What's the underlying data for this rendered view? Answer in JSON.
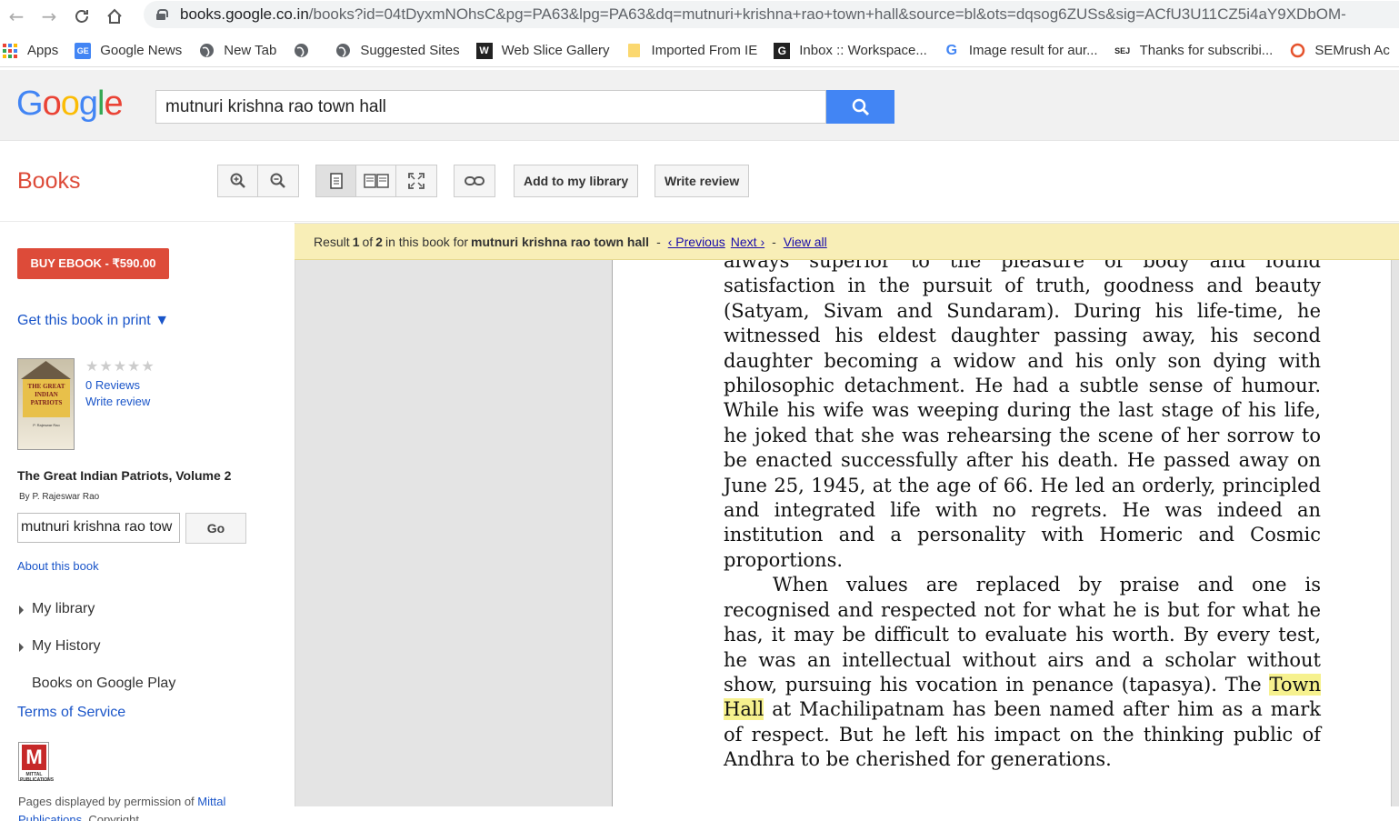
{
  "browser": {
    "url_host": "books.google.co.in",
    "url_rest": "/books?id=04tDyxmNOhsC&pg=PA63&lpg=PA63&dq=mutnuri+krishna+rao+town+hall&source=bl&ots=dqsog6ZUSs&sig=ACfU3U11CZ5i4aY9XDbOM-"
  },
  "bookmarks": [
    {
      "label": "Apps",
      "icon": "apps-grid-icon"
    },
    {
      "label": "Google News",
      "icon": "google-news-icon"
    },
    {
      "label": "New Tab",
      "icon": "globe-icon"
    },
    {
      "label": "",
      "icon": "globe-icon"
    },
    {
      "label": "Suggested Sites",
      "icon": "globe-icon"
    },
    {
      "label": "Web Slice Gallery",
      "icon": "web-slice-icon"
    },
    {
      "label": "Imported From IE",
      "icon": "folder-icon"
    },
    {
      "label": "Inbox :: Workspace...",
      "icon": "g-square-icon"
    },
    {
      "label": "Image result for aur...",
      "icon": "google-g-icon"
    },
    {
      "label": "Thanks for subscribi...",
      "icon": "sej-icon"
    },
    {
      "label": "SEMrush Ac",
      "icon": "semrush-icon"
    }
  ],
  "header": {
    "search_query": "mutnuri krishna rao town hall"
  },
  "books": {
    "title": "Books",
    "add_library_label": "Add to my library",
    "write_review_label": "Write review"
  },
  "sidebar": {
    "buy_label": "BUY EBOOK - ₹590.00",
    "get_print_label": "Get this book in print ▼",
    "reviews_label": "0 Reviews",
    "write_review_label": "Write review",
    "book_title": "The Great Indian Patriots, Volume 2",
    "author": "By P. Rajeswar Rao",
    "search_value": "mutnuri krishna rao tow",
    "go_label": "Go",
    "about_label": "About this book",
    "my_library": "My library",
    "my_history": "My History",
    "books_play": "Books on Google Play",
    "terms": "Terms of Service",
    "permission_text": "Pages displayed by permission of ",
    "publisher_link": "Mittal Publications",
    "copyright": ". Copyright.",
    "cover_title": "THE GREAT INDIAN PATRIOTS",
    "cover_author": "P. Rajeswar Rao",
    "publisher_logo_letter": "M",
    "publisher_logo_text": "MITTAL PUBLICATIONS",
    "rating": 0
  },
  "result_bar": {
    "result_label": "Result",
    "result_num": "1",
    "of_label": "of",
    "total": "2",
    "in_book_label": "in this book for",
    "query": "mutnuri krishna rao town hall",
    "sep1": "-",
    "previous": "‹ Previous",
    "next": "Next ›",
    "sep2": "-",
    "view_all": "View all"
  },
  "page_text": {
    "line0": "always superior to the pleasure of body and found",
    "para1": "satisfaction in the pursuit of truth, goodness and beauty (Satyam, Sivam and Sundaram). During his life-time, he witnessed his eldest daughter passing away, his second daughter becoming a widow and his only son dying with philosophic detachment. He had a subtle sense of humour. While his wife was weeping during the last stage of his life, he joked that she was rehearsing the scene of her sorrow to be enacted successfully after his death. He passed away on June 25, 1945, at the age of 66. He led an orderly, principled and integrated life with no regrets. He was indeed an institution and a personality with Homeric and Cosmic proportions.",
    "para2_a": "When values are replaced by praise and one is recognised and respected not for what he is but for what he has, it may be difficult to evaluate his worth. By every test, he was an intellectual without airs and a scholar without show, pursuing his vocation in penance (tapasya). The",
    "para2_hl": "Town Hall",
    "para2_b": "at Machilipatnam has been named after him as a mark of respect. But he left his impact on the thinking public of Andhra to be cherished for generations."
  }
}
